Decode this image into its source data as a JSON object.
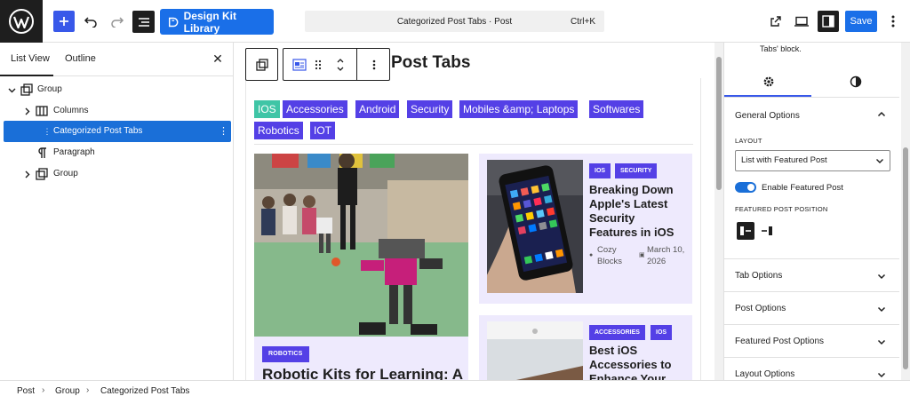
{
  "toolbar": {
    "design_kit_label": "Design Kit Library",
    "command_title": "Categorized Post Tabs · Post",
    "command_shortcut": "Ctrl+K",
    "save_label": "Save",
    "accent": "#3858e9"
  },
  "list_view": {
    "tabs": [
      {
        "label": "List View",
        "active": true
      },
      {
        "label": "Outline",
        "active": false
      }
    ],
    "close_label": "✕",
    "items": [
      {
        "label": "Group",
        "icon": "group-icon",
        "expandable": true,
        "expanded": true
      },
      {
        "label": "Columns",
        "icon": "columns-icon",
        "expandable": true,
        "expanded": false
      },
      {
        "label": "Categorized Post Tabs",
        "icon": "post-tabs-icon",
        "selected": true
      },
      {
        "label": "Paragraph",
        "icon": "paragraph-icon"
      },
      {
        "label": "Group",
        "icon": "group-icon",
        "expandable": true,
        "expanded": false
      }
    ]
  },
  "canvas": {
    "heading": "Post Tabs",
    "tabs": [
      {
        "label": "IOS",
        "active": true
      },
      {
        "label": "Accessories"
      },
      {
        "label": "Android"
      },
      {
        "label": "Security"
      },
      {
        "label": "Mobiles &amp; Laptops"
      },
      {
        "label": "Softwares"
      },
      {
        "label": "Robotics"
      },
      {
        "label": "IOT"
      }
    ],
    "featured": {
      "badge": "ROBOTICS",
      "title": "Robotic Kits for Learning: A"
    },
    "posts": [
      {
        "badges": [
          "IOS",
          "SECURITY"
        ],
        "title_lines": [
          "Breaking Down",
          "Apple's Latest",
          "Security",
          "Features in iOS"
        ],
        "author_lines": [
          "Cozy",
          "Blocks"
        ],
        "date_lines": [
          "March 10,",
          "2026"
        ]
      },
      {
        "badges": [
          "ACCESSORIES",
          "IOS"
        ],
        "title_lines": [
          "Best iOS",
          "Accessories to",
          "Enhance Your"
        ]
      }
    ],
    "tab_color": "#5440e6",
    "tab_active_color": "#3fc5a6",
    "card_bg": "#eeeafd"
  },
  "settings": {
    "description": "Tabs' block.",
    "general_title": "General Options",
    "layout_label": "LAYOUT",
    "layout_value": "List with Featured Post",
    "toggle_label": "Enable Featured Post",
    "toggle_on": true,
    "position_label": "FEATURED POST POSITION",
    "sections": [
      "Tab Options",
      "Post Options",
      "Featured Post Options",
      "Layout Options"
    ]
  },
  "breadcrumb": [
    "Post",
    "Group",
    "Categorized Post Tabs"
  ]
}
